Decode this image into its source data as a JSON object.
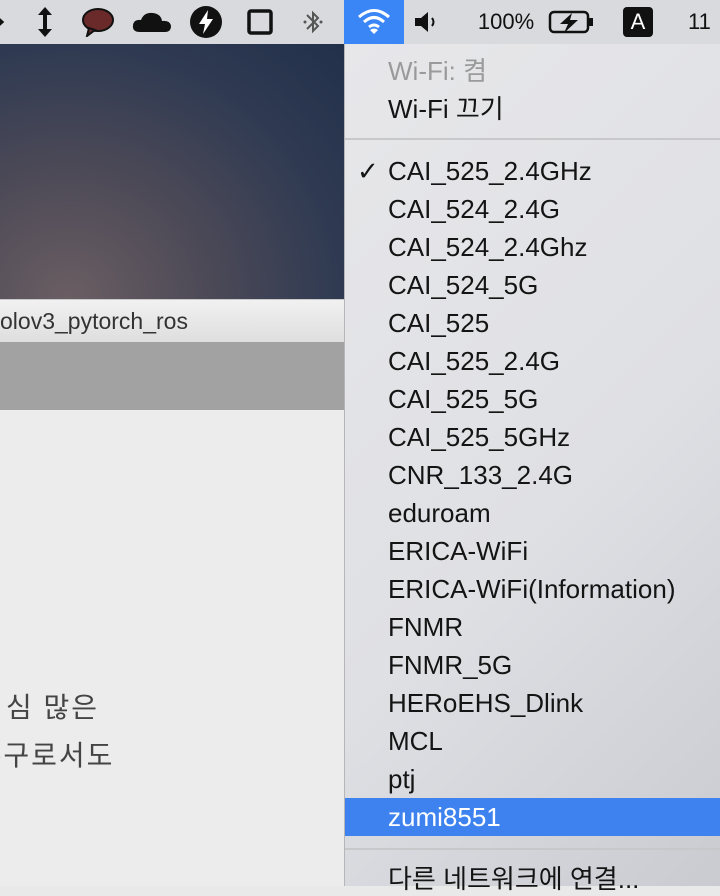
{
  "menubar": {
    "battery_percent": "100%",
    "input_source": "A",
    "clock_partial": "11"
  },
  "window": {
    "title_partial": "olov3_pytorch_ros",
    "body_line1": "심 많은",
    "body_line2": "-구로서도"
  },
  "wifi_menu": {
    "status": "Wi-Fi: 켬",
    "toggle": "Wi-Fi 끄기",
    "networks": [
      {
        "name": "CAI_525_2.4GHz",
        "connected": true
      },
      {
        "name": "CAI_524_2.4G"
      },
      {
        "name": "CAI_524_2.4Ghz"
      },
      {
        "name": "CAI_524_5G"
      },
      {
        "name": "CAI_525"
      },
      {
        "name": "CAI_525_2.4G"
      },
      {
        "name": "CAI_525_5G"
      },
      {
        "name": "CAI_525_5GHz"
      },
      {
        "name": "CNR_133_2.4G"
      },
      {
        "name": "eduroam"
      },
      {
        "name": "ERICA-WiFi"
      },
      {
        "name": "ERICA-WiFi(Information)"
      },
      {
        "name": "FNMR"
      },
      {
        "name": "FNMR_5G"
      },
      {
        "name": "HERoEHS_Dlink"
      },
      {
        "name": "MCL"
      },
      {
        "name": "ptj"
      },
      {
        "name": "zumi8551",
        "highlighted": true
      }
    ],
    "join_other": "다른 네트워크에 연결...",
    "check_mark": "✓"
  }
}
